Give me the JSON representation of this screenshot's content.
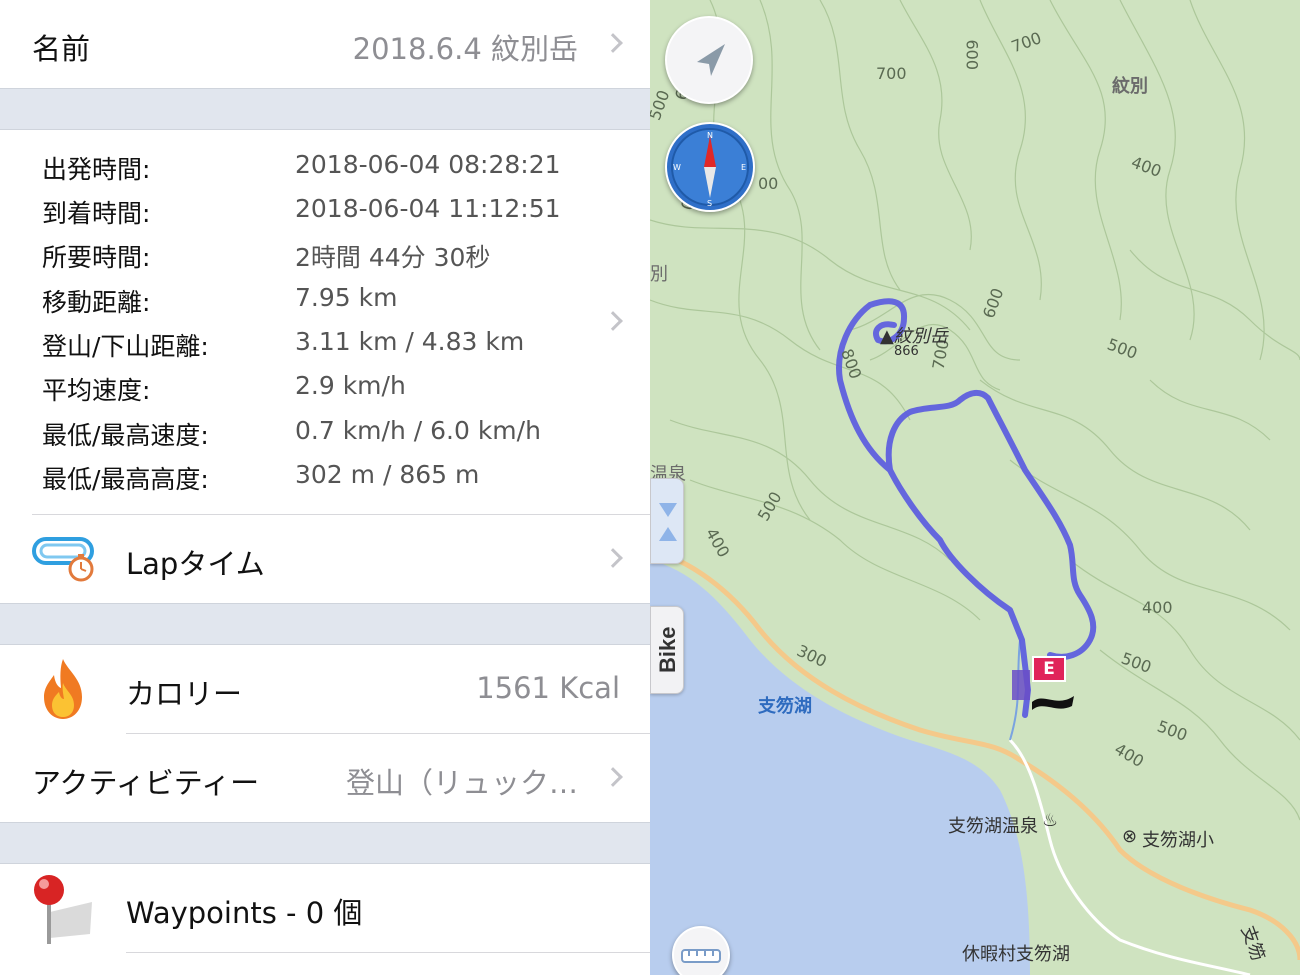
{
  "header": {
    "label": "名前",
    "value": "2018.6.4 紋別岳"
  },
  "stats": [
    {
      "key": "出発時間:",
      "value": "2018-06-04 08:28:21"
    },
    {
      "key": "到着時間:",
      "value": "2018-06-04 11:12:51"
    },
    {
      "key": "所要時間:",
      "value": "2時間 44分 30秒"
    },
    {
      "key": "移動距離:",
      "value": "7.95 km"
    },
    {
      "key": "登山/下山距離:",
      "value": "3.11 km / 4.83 km"
    },
    {
      "key": "平均速度:",
      "value": "2.9 km/h"
    },
    {
      "key": "最低/最高速度:",
      "value": "0.7 km/h / 6.0 km/h"
    },
    {
      "key": "最低/最高高度:",
      "value": "302 m / 865 m"
    }
  ],
  "lap": {
    "label": "Lapタイム",
    "icon": "lap-timer-icon"
  },
  "calorie": {
    "label": "カロリー",
    "value": "1561 Kcal",
    "icon": "flame-icon"
  },
  "activity": {
    "label": "アクティビティー",
    "value": "登山（リュック…"
  },
  "waypoints": {
    "label": "Waypoints - 0 個",
    "icon": "pin-icon"
  },
  "map": {
    "summit_name": "▲紋別岳",
    "summit_elev": "866",
    "lake_name": "支笏湖",
    "onsen_name": "支笏湖温泉",
    "school_name": "支笏湖小",
    "kyuka_name": "休暇村支笏湖",
    "area_name": "紋別",
    "left_clip_1": "別",
    "left_clip_2": "温泉",
    "bottom_right_clip": "支笏",
    "end_marker": "E",
    "bike_tab": "Bike",
    "contours": [
      "700",
      "700",
      "600",
      "400",
      "600",
      "500",
      "500",
      "700",
      "800",
      "600",
      "500",
      "400",
      "300",
      "400",
      "500",
      "500",
      "400",
      "00",
      "00"
    ],
    "route_color": "#5c5ce0",
    "water_color": "#b8cdee",
    "land_color": "#cfe3c0",
    "road_color": "#f4c98a"
  },
  "controls": {
    "locate_icon": "location-arrow-icon",
    "compass_icon": "compass-icon",
    "ruler_icon": "ruler-icon",
    "collapse_icon": "split-arrows-icon"
  }
}
